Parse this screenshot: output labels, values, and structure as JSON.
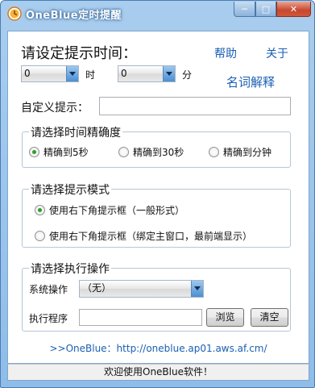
{
  "window": {
    "title": "OneBlue定时提醒",
    "min_glyph": "─",
    "max_glyph": "□",
    "close_glyph": "✕"
  },
  "header": {
    "prompt": "请设定提示时间：",
    "help": "帮助",
    "about": "关于",
    "glossary": "名词解释"
  },
  "time": {
    "hour_value": "0",
    "hour_unit": "时",
    "minute_value": "0",
    "minute_unit": "分"
  },
  "custom": {
    "label": "自定义提示：",
    "value": ""
  },
  "precision": {
    "title": "请选择时间精确度",
    "options": [
      {
        "label": "精确到5秒",
        "selected": true
      },
      {
        "label": "精确到30秒",
        "selected": false
      },
      {
        "label": "精确到分钟",
        "selected": false
      }
    ]
  },
  "mode": {
    "title": "请选择提示模式",
    "options": [
      {
        "label": "使用右下角提示框（一般形式）",
        "selected": true
      },
      {
        "label": "使用右下角提示框（绑定主窗口，最前端显示）",
        "selected": false
      }
    ]
  },
  "action": {
    "title": "请选择执行操作",
    "sys_label": "系统操作",
    "sys_value": "（无）",
    "exec_label": "执行程序",
    "exec_value": "",
    "browse": "浏览",
    "clear": "清空"
  },
  "footer_link": ">>OneBlue：http://oneblue.ap01.aws.af.cm/",
  "status": "欢迎使用OneBlue软件！"
}
